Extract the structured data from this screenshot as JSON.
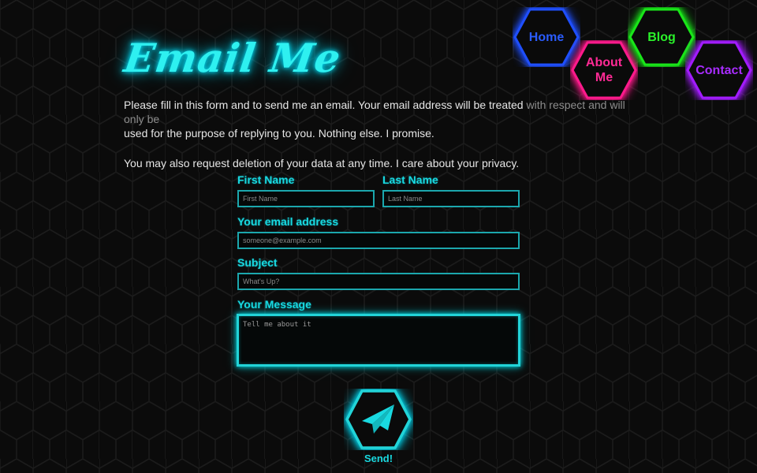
{
  "page": {
    "title": "Email Me",
    "intro_part1": "Please fill in this form and to send me an email. Your email address will be treated ",
    "intro_part2": "with respect and will only be",
    "intro_part3": "used for the purpose of replying to you. Nothing else. I promise.",
    "intro_privacy": "You may also request deletion of your data at any time. I care about your privacy."
  },
  "nav": {
    "home": {
      "label": "Home",
      "color": "#1f4fff"
    },
    "about": {
      "label": "About Me",
      "color": "#ff1a8c"
    },
    "blog": {
      "label": "Blog",
      "color": "#19e619"
    },
    "contact": {
      "label": "Contact",
      "color": "#a21cff"
    }
  },
  "form": {
    "first_name": {
      "label": "First Name",
      "placeholder": "First Name",
      "value": ""
    },
    "last_name": {
      "label": "Last Name",
      "placeholder": "Last Name",
      "value": ""
    },
    "email": {
      "label": "Your email address",
      "placeholder": "someone@example.com",
      "value": ""
    },
    "subject": {
      "label": "Subject",
      "placeholder": "What's Up?",
      "value": ""
    },
    "message": {
      "label": "Your Message",
      "placeholder": "Tell me about it",
      "value": ""
    },
    "send": {
      "label": "Send!",
      "icon": "paper-plane-icon"
    }
  },
  "colors": {
    "accent": "#19d9e0",
    "background": "#0a0a0a"
  }
}
